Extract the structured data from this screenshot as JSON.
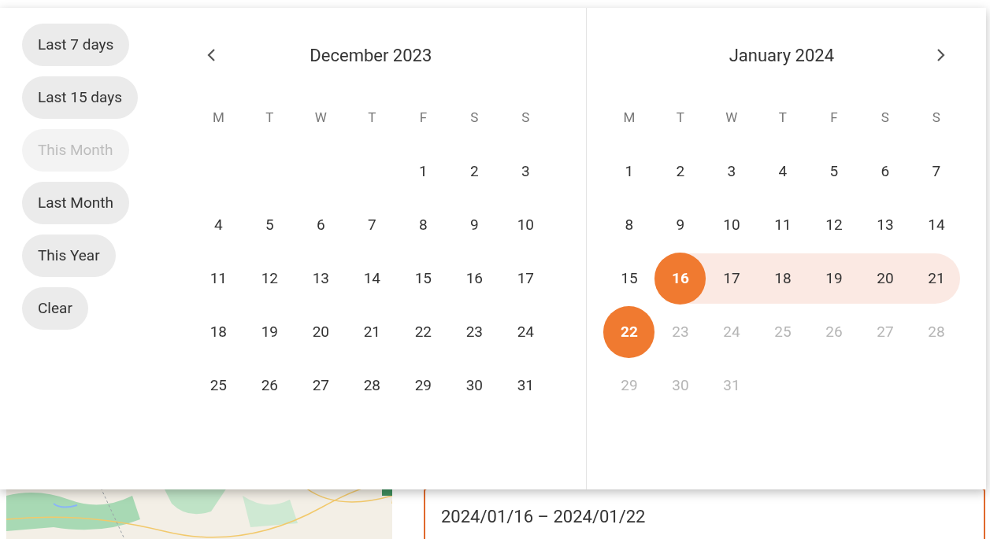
{
  "presets": [
    {
      "label": "Last 7 days",
      "disabled": false
    },
    {
      "label": "Last 15 days",
      "disabled": false
    },
    {
      "label": "This Month",
      "disabled": true
    },
    {
      "label": "Last Month",
      "disabled": false
    },
    {
      "label": "This Year",
      "disabled": false
    },
    {
      "label": "Clear",
      "disabled": false
    }
  ],
  "calendars": [
    {
      "title": "December 2023",
      "nav_prev": true,
      "nav_next": false,
      "weekdays": [
        "M",
        "T",
        "W",
        "T",
        "F",
        "S",
        "S"
      ],
      "days": [
        {
          "kind": "blank"
        },
        {
          "kind": "blank"
        },
        {
          "kind": "blank"
        },
        {
          "kind": "blank"
        },
        {
          "kind": "day",
          "label": "1",
          "disabled": false,
          "selected": false,
          "in_range": false
        },
        {
          "kind": "day",
          "label": "2",
          "disabled": false,
          "selected": false,
          "in_range": false
        },
        {
          "kind": "day",
          "label": "3",
          "disabled": false,
          "selected": false,
          "in_range": false
        },
        {
          "kind": "day",
          "label": "4",
          "disabled": false,
          "selected": false,
          "in_range": false
        },
        {
          "kind": "day",
          "label": "5",
          "disabled": false,
          "selected": false,
          "in_range": false
        },
        {
          "kind": "day",
          "label": "6",
          "disabled": false,
          "selected": false,
          "in_range": false
        },
        {
          "kind": "day",
          "label": "7",
          "disabled": false,
          "selected": false,
          "in_range": false
        },
        {
          "kind": "day",
          "label": "8",
          "disabled": false,
          "selected": false,
          "in_range": false
        },
        {
          "kind": "day",
          "label": "9",
          "disabled": false,
          "selected": false,
          "in_range": false
        },
        {
          "kind": "day",
          "label": "10",
          "disabled": false,
          "selected": false,
          "in_range": false
        },
        {
          "kind": "day",
          "label": "11",
          "disabled": false,
          "selected": false,
          "in_range": false
        },
        {
          "kind": "day",
          "label": "12",
          "disabled": false,
          "selected": false,
          "in_range": false
        },
        {
          "kind": "day",
          "label": "13",
          "disabled": false,
          "selected": false,
          "in_range": false
        },
        {
          "kind": "day",
          "label": "14",
          "disabled": false,
          "selected": false,
          "in_range": false
        },
        {
          "kind": "day",
          "label": "15",
          "disabled": false,
          "selected": false,
          "in_range": false
        },
        {
          "kind": "day",
          "label": "16",
          "disabled": false,
          "selected": false,
          "in_range": false
        },
        {
          "kind": "day",
          "label": "17",
          "disabled": false,
          "selected": false,
          "in_range": false
        },
        {
          "kind": "day",
          "label": "18",
          "disabled": false,
          "selected": false,
          "in_range": false
        },
        {
          "kind": "day",
          "label": "19",
          "disabled": false,
          "selected": false,
          "in_range": false
        },
        {
          "kind": "day",
          "label": "20",
          "disabled": false,
          "selected": false,
          "in_range": false
        },
        {
          "kind": "day",
          "label": "21",
          "disabled": false,
          "selected": false,
          "in_range": false
        },
        {
          "kind": "day",
          "label": "22",
          "disabled": false,
          "selected": false,
          "in_range": false
        },
        {
          "kind": "day",
          "label": "23",
          "disabled": false,
          "selected": false,
          "in_range": false
        },
        {
          "kind": "day",
          "label": "24",
          "disabled": false,
          "selected": false,
          "in_range": false
        },
        {
          "kind": "day",
          "label": "25",
          "disabled": false,
          "selected": false,
          "in_range": false
        },
        {
          "kind": "day",
          "label": "26",
          "disabled": false,
          "selected": false,
          "in_range": false
        },
        {
          "kind": "day",
          "label": "27",
          "disabled": false,
          "selected": false,
          "in_range": false
        },
        {
          "kind": "day",
          "label": "28",
          "disabled": false,
          "selected": false,
          "in_range": false
        },
        {
          "kind": "day",
          "label": "29",
          "disabled": false,
          "selected": false,
          "in_range": false
        },
        {
          "kind": "day",
          "label": "30",
          "disabled": false,
          "selected": false,
          "in_range": false
        },
        {
          "kind": "day",
          "label": "31",
          "disabled": false,
          "selected": false,
          "in_range": false
        }
      ]
    },
    {
      "title": "January 2024",
      "nav_prev": false,
      "nav_next": true,
      "weekdays": [
        "M",
        "T",
        "W",
        "T",
        "F",
        "S",
        "S"
      ],
      "days": [
        {
          "kind": "day",
          "label": "1",
          "disabled": false,
          "selected": false,
          "in_range": false
        },
        {
          "kind": "day",
          "label": "2",
          "disabled": false,
          "selected": false,
          "in_range": false
        },
        {
          "kind": "day",
          "label": "3",
          "disabled": false,
          "selected": false,
          "in_range": false
        },
        {
          "kind": "day",
          "label": "4",
          "disabled": false,
          "selected": false,
          "in_range": false
        },
        {
          "kind": "day",
          "label": "5",
          "disabled": false,
          "selected": false,
          "in_range": false
        },
        {
          "kind": "day",
          "label": "6",
          "disabled": false,
          "selected": false,
          "in_range": false
        },
        {
          "kind": "day",
          "label": "7",
          "disabled": false,
          "selected": false,
          "in_range": false
        },
        {
          "kind": "day",
          "label": "8",
          "disabled": false,
          "selected": false,
          "in_range": false
        },
        {
          "kind": "day",
          "label": "9",
          "disabled": false,
          "selected": false,
          "in_range": false
        },
        {
          "kind": "day",
          "label": "10",
          "disabled": false,
          "selected": false,
          "in_range": false
        },
        {
          "kind": "day",
          "label": "11",
          "disabled": false,
          "selected": false,
          "in_range": false
        },
        {
          "kind": "day",
          "label": "12",
          "disabled": false,
          "selected": false,
          "in_range": false
        },
        {
          "kind": "day",
          "label": "13",
          "disabled": false,
          "selected": false,
          "in_range": false
        },
        {
          "kind": "day",
          "label": "14",
          "disabled": false,
          "selected": false,
          "in_range": false
        },
        {
          "kind": "day",
          "label": "15",
          "disabled": false,
          "selected": false,
          "in_range": false
        },
        {
          "kind": "day",
          "label": "16",
          "disabled": false,
          "selected": true,
          "in_range": true
        },
        {
          "kind": "day",
          "label": "17",
          "disabled": false,
          "selected": false,
          "in_range": true
        },
        {
          "kind": "day",
          "label": "18",
          "disabled": false,
          "selected": false,
          "in_range": true
        },
        {
          "kind": "day",
          "label": "19",
          "disabled": false,
          "selected": false,
          "in_range": true
        },
        {
          "kind": "day",
          "label": "20",
          "disabled": false,
          "selected": false,
          "in_range": true
        },
        {
          "kind": "day",
          "label": "21",
          "disabled": false,
          "selected": false,
          "in_range": true
        },
        {
          "kind": "day",
          "label": "22",
          "disabled": false,
          "selected": true,
          "in_range": false
        },
        {
          "kind": "day",
          "label": "23",
          "disabled": true,
          "selected": false,
          "in_range": false
        },
        {
          "kind": "day",
          "label": "24",
          "disabled": true,
          "selected": false,
          "in_range": false
        },
        {
          "kind": "day",
          "label": "25",
          "disabled": true,
          "selected": false,
          "in_range": false
        },
        {
          "kind": "day",
          "label": "26",
          "disabled": true,
          "selected": false,
          "in_range": false
        },
        {
          "kind": "day",
          "label": "27",
          "disabled": true,
          "selected": false,
          "in_range": false
        },
        {
          "kind": "day",
          "label": "28",
          "disabled": true,
          "selected": false,
          "in_range": false
        },
        {
          "kind": "day",
          "label": "29",
          "disabled": true,
          "selected": false,
          "in_range": false
        },
        {
          "kind": "day",
          "label": "30",
          "disabled": true,
          "selected": false,
          "in_range": false
        },
        {
          "kind": "day",
          "label": "31",
          "disabled": true,
          "selected": false,
          "in_range": false
        }
      ]
    }
  ],
  "page": {
    "date_field": {
      "value": "2024/01/16 – 2024/01/22",
      "focused": true
    }
  }
}
